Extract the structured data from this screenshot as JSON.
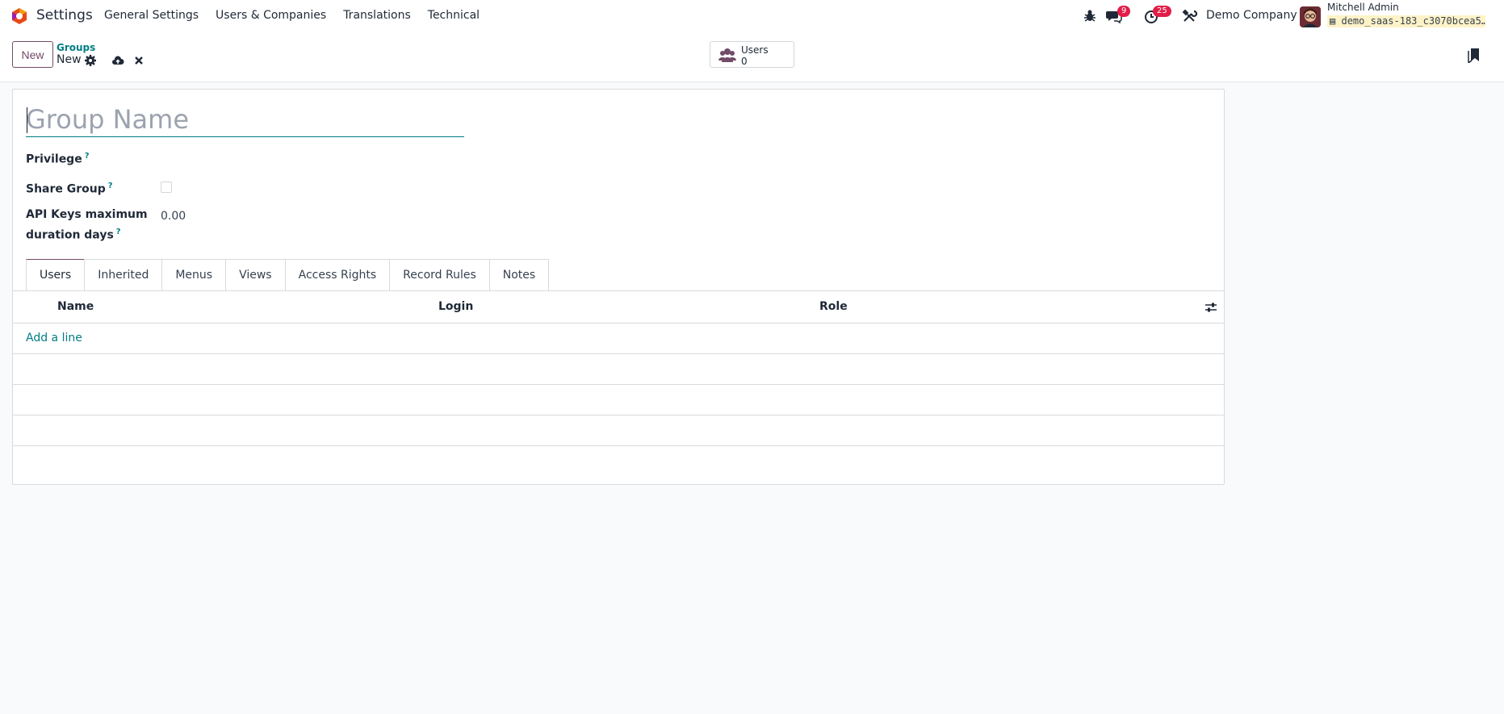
{
  "navbar": {
    "app_name": "Settings",
    "menu": [
      "General Settings",
      "Users & Companies",
      "Translations",
      "Technical"
    ],
    "messages_count": "9",
    "activities_count": "25",
    "company": "Demo Company",
    "user_name": "Mitchell Admin",
    "database": "demo_saas-183_c3070bcea5…"
  },
  "control": {
    "new_label": "New",
    "breadcrumb": "Groups",
    "record_name": "New",
    "stat_label": "Users",
    "stat_value": "0"
  },
  "form": {
    "name_placeholder": "Group Name",
    "privilege_label": "Privilege",
    "share_group_label": "Share Group",
    "api_keys_label_1": "API Keys maximum",
    "api_keys_label_2": "duration days",
    "api_keys_value": "0.00",
    "help_mark": "?"
  },
  "tabs": [
    "Users",
    "Inherited",
    "Menus",
    "Views",
    "Access Rights",
    "Record Rules",
    "Notes"
  ],
  "table": {
    "columns": [
      "Name",
      "Login",
      "Role"
    ],
    "add_line": "Add a line"
  },
  "colors": {
    "brand": "#714b67",
    "accent": "#017e84",
    "badge": "#e11d48"
  }
}
